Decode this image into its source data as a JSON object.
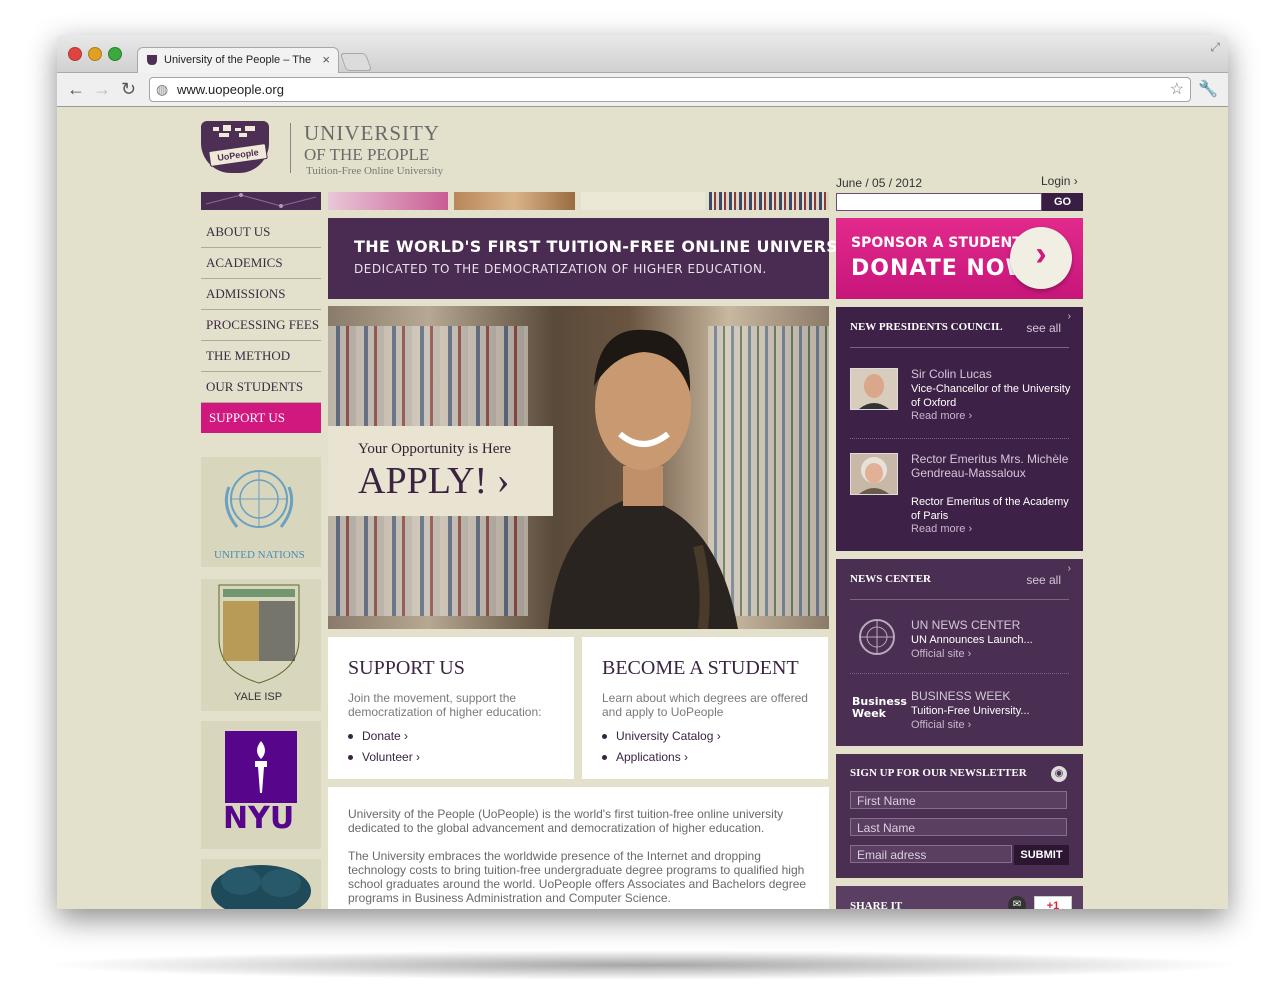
{
  "browser": {
    "tab_title": "University of the People – The",
    "tab_close": "×",
    "url": "www.uopeople.org"
  },
  "logo": {
    "badge": "UoPeople",
    "line1": "UNIVERSITY",
    "line2": "OF THE PEOPLE",
    "line3": "Tuition-Free Online University"
  },
  "header": {
    "date": "June / 05 / 2012",
    "login": "Login ›",
    "go": "GO"
  },
  "nav": {
    "items": [
      {
        "label": "ABOUT US"
      },
      {
        "label": "ACADEMICS"
      },
      {
        "label": "ADMISSIONS"
      },
      {
        "label": "PROCESSING FEES"
      },
      {
        "label": "THE METHOD"
      },
      {
        "label": "OUR STUDENTS"
      },
      {
        "label": "SUPPORT US"
      }
    ]
  },
  "partners": {
    "un": "UNITED NATIONS",
    "yale": "YALE ISP",
    "nyu": "NYU"
  },
  "banner": {
    "line1": "THE WORLD'S FIRST TUITION-FREE ONLINE UNIVERSITY",
    "line2": "DEDICATED TO THE DEMOCRATIZATION OF HIGHER EDUCATION."
  },
  "donate": {
    "line1": "SPONSOR A STUDENT",
    "line2": "DONATE NOW",
    "arrow": "›"
  },
  "hero": {
    "tagline": "Your Opportunity is Here",
    "cta": "APPLY! ›"
  },
  "council": {
    "title": "NEW PRESIDENTS COUNCIL",
    "see_all": "see all",
    "members": [
      {
        "name": "Sir Colin Lucas",
        "title": "Vice-Chancellor of the University of Oxford",
        "more": "Read more ›"
      },
      {
        "name": "Rector Emeritus Mrs. Michèle Gendreau-Massaloux",
        "title": "Rector Emeritus of the Academy of Paris",
        "more": "Read more ›"
      }
    ]
  },
  "news": {
    "title": "NEWS CENTER",
    "see_all": "see all",
    "items": [
      {
        "source": "UN NEWS CENTER",
        "headline": "UN Announces Launch...",
        "link": "Official site ›"
      },
      {
        "source": "BUSINESS WEEK",
        "logo": "Business Week",
        "headline": "Tuition-Free University...",
        "link": "Official site ›"
      }
    ]
  },
  "newsletter": {
    "title": "SIGN UP FOR OUR NEWSLETTER",
    "first_name": "First Name",
    "last_name": "Last Name",
    "email": "Email adress",
    "submit": "SUBMIT"
  },
  "share": {
    "title": "SHARE IT",
    "gplus": "+1"
  },
  "support_card": {
    "title": "SUPPORT US",
    "desc": "Join the movement, support the democratization of higher education:",
    "links": [
      "Donate ›",
      "Volunteer ›"
    ]
  },
  "student_card": {
    "title": "BECOME A STUDENT",
    "desc": "Learn about which degrees are offered and apply to UoPeople",
    "links": [
      "University Catalog ›",
      "Applications ›"
    ]
  },
  "about": {
    "p1": "University of the People (UoPeople) is the world's first tuition-free online university dedicated to the global advancement and democratization of higher education.",
    "p2": "The University embraces the worldwide presence of the Internet and dropping technology costs to bring tuition-free undergraduate degree programs to qualified high school graduates around the world. UoPeople offers Associates and Bachelors degree programs in Business Administration and Computer Science."
  },
  "colors": {
    "purple": "#4a2c52",
    "magenta": "#d1187f",
    "page_bg": "#e3e1cb"
  }
}
